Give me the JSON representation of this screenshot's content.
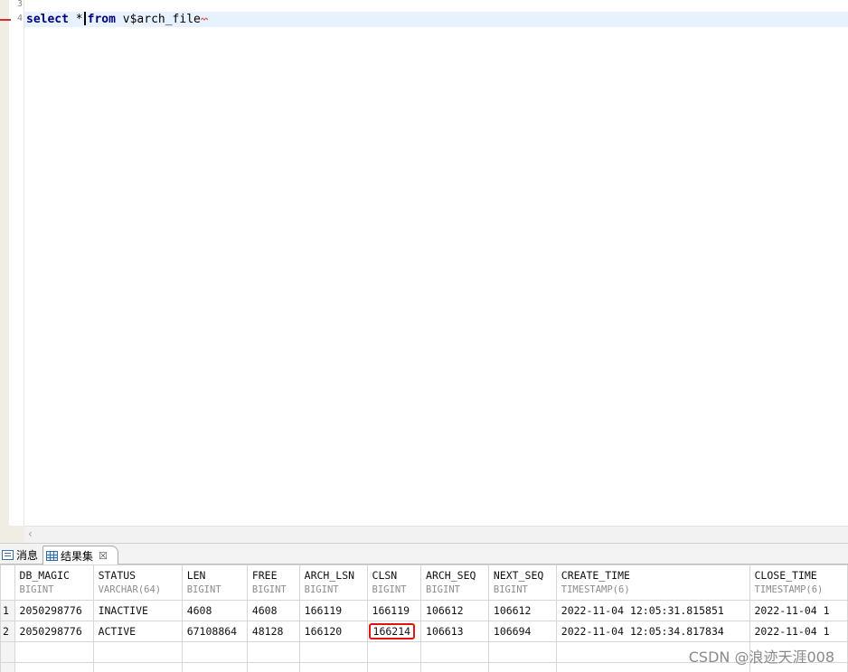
{
  "editor": {
    "line_numbers": [
      "3",
      "4"
    ],
    "code": {
      "kw_select": "select",
      "star": " *",
      "kw_from": "from",
      "table": " v$arch_file"
    }
  },
  "panel": {
    "tabs": [
      {
        "label": "消息",
        "icon": "message-icon"
      },
      {
        "label": "结果集",
        "icon": "grid-icon",
        "close": "☒"
      }
    ]
  },
  "result": {
    "columns": [
      {
        "name": "DB_MAGIC",
        "type": "BIGINT"
      },
      {
        "name": "STATUS",
        "type": "VARCHAR(64)"
      },
      {
        "name": "LEN",
        "type": "BIGINT"
      },
      {
        "name": "FREE",
        "type": "BIGINT"
      },
      {
        "name": "ARCH_LSN",
        "type": "BIGINT"
      },
      {
        "name": "CLSN",
        "type": "BIGINT"
      },
      {
        "name": "ARCH_SEQ",
        "type": "BIGINT"
      },
      {
        "name": "NEXT_SEQ",
        "type": "BIGINT"
      },
      {
        "name": "CREATE_TIME",
        "type": "TIMESTAMP(6)"
      },
      {
        "name": "CLOSE_TIME",
        "type": "TIMESTAMP(6)"
      }
    ],
    "rows": [
      {
        "num": "1",
        "cells": [
          "2050298776",
          "INACTIVE",
          "4608",
          "4608",
          "166119",
          "166119",
          "106612",
          "106612",
          "2022-11-04 12:05:31.815851",
          "2022-11-04 1"
        ]
      },
      {
        "num": "2",
        "cells": [
          "2050298776",
          "ACTIVE",
          "67108864",
          "48128",
          "166120",
          "166214",
          "106613",
          "106694",
          "2022-11-04 12:05:34.817834",
          "2022-11-04 1"
        ]
      }
    ],
    "highlight": {
      "row": 1,
      "col": 5,
      "color": "#e1140f"
    }
  },
  "watermark": "CSDN @浪迹天涯008"
}
